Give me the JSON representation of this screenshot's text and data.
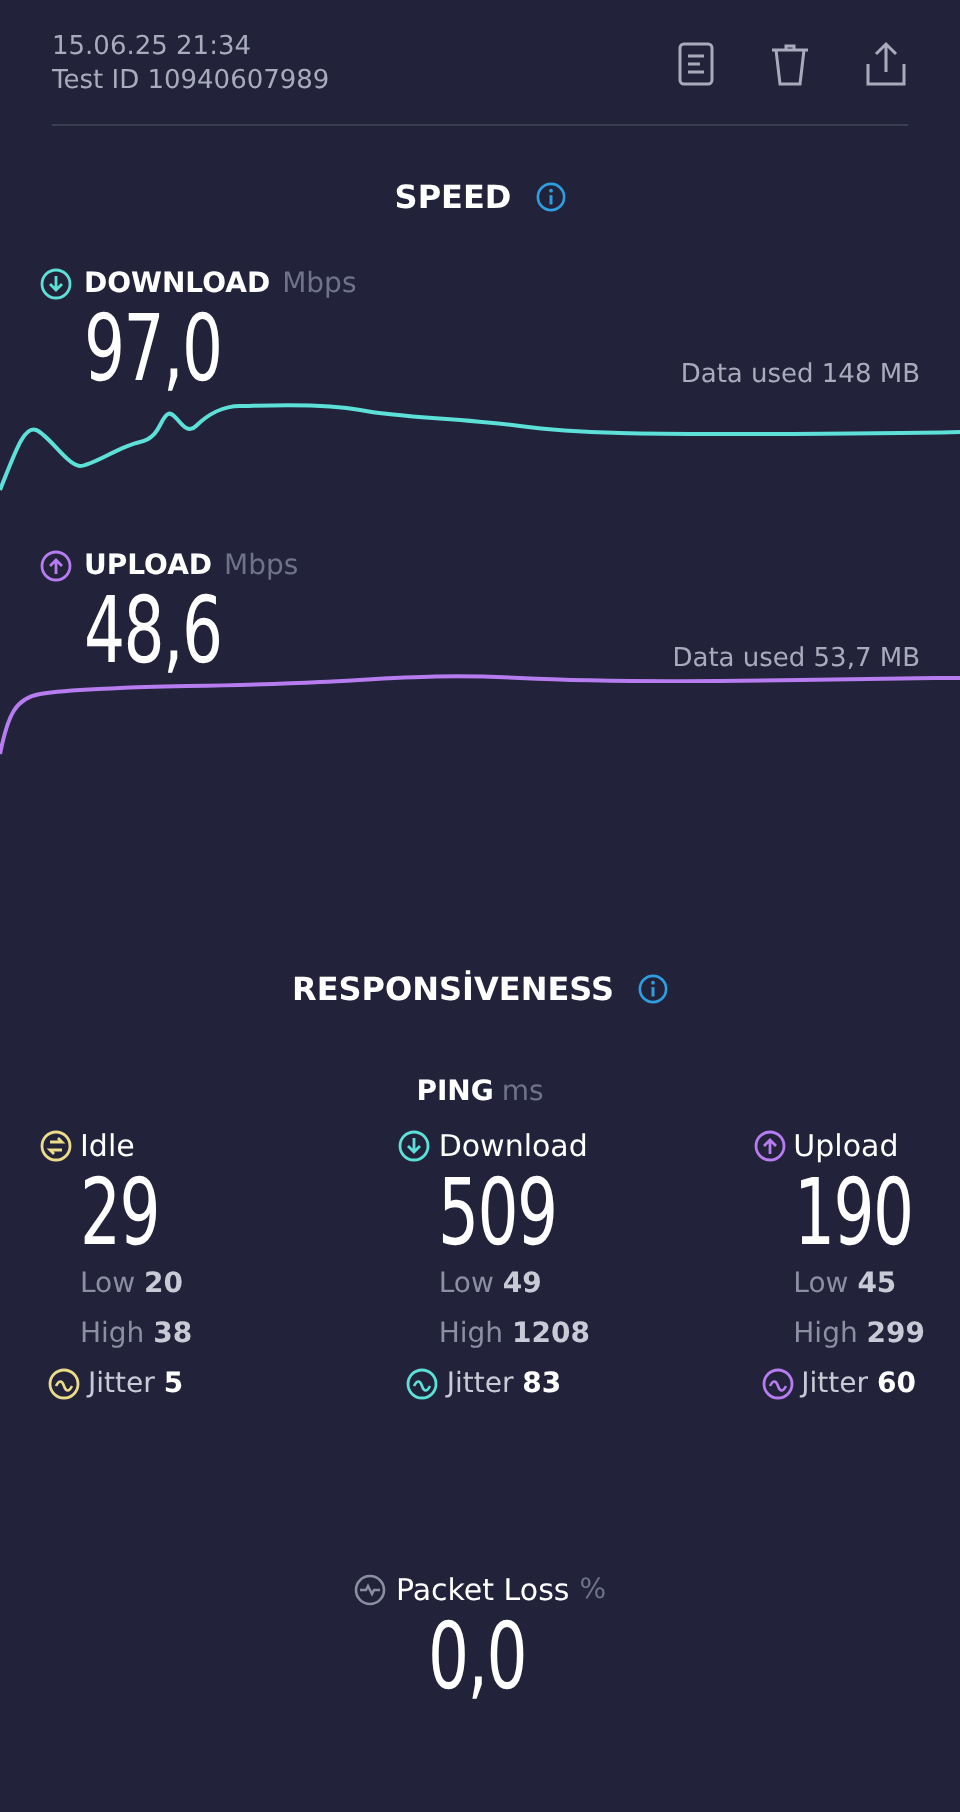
{
  "header": {
    "date": "15.06.25 21:34",
    "test_id": "Test ID 10940607989"
  },
  "speed": {
    "title": "SPEED",
    "tests": [
      {
        "kind": "download",
        "label": "DOWNLOAD",
        "unit": "Mbps",
        "value": "97,0",
        "data_used": "Data used 148 MB",
        "color": "#5ce0d8"
      },
      {
        "kind": "upload",
        "label": "UPLOAD",
        "unit": "Mbps",
        "value": "48,6",
        "data_used": "Data used 53,7 MB",
        "color": "#b67cf0"
      }
    ]
  },
  "responsiveness": {
    "title": "RESPONSİVENESS",
    "ping_label": "PING",
    "ping_unit": "ms",
    "columns": [
      {
        "kind": "idle",
        "label": "Idle",
        "value": "29",
        "low_label": "Low",
        "low": "20",
        "high_label": "High",
        "high": "38",
        "jitter_label": "Jitter",
        "jitter": "5",
        "color": "#ecdc8a"
      },
      {
        "kind": "download",
        "label": "Download",
        "value": "509",
        "low_label": "Low",
        "low": "49",
        "high_label": "High",
        "high": "1208",
        "jitter_label": "Jitter",
        "jitter": "83",
        "color": "#5ce0d8"
      },
      {
        "kind": "upload",
        "label": "Upload",
        "value": "190",
        "low_label": "Low",
        "low": "45",
        "high_label": "High",
        "high": "299",
        "jitter_label": "Jitter",
        "jitter": "60",
        "color": "#b67cf0"
      }
    ]
  },
  "packet_loss": {
    "label": "Packet Loss",
    "unit": "%",
    "value": "0,0"
  }
}
